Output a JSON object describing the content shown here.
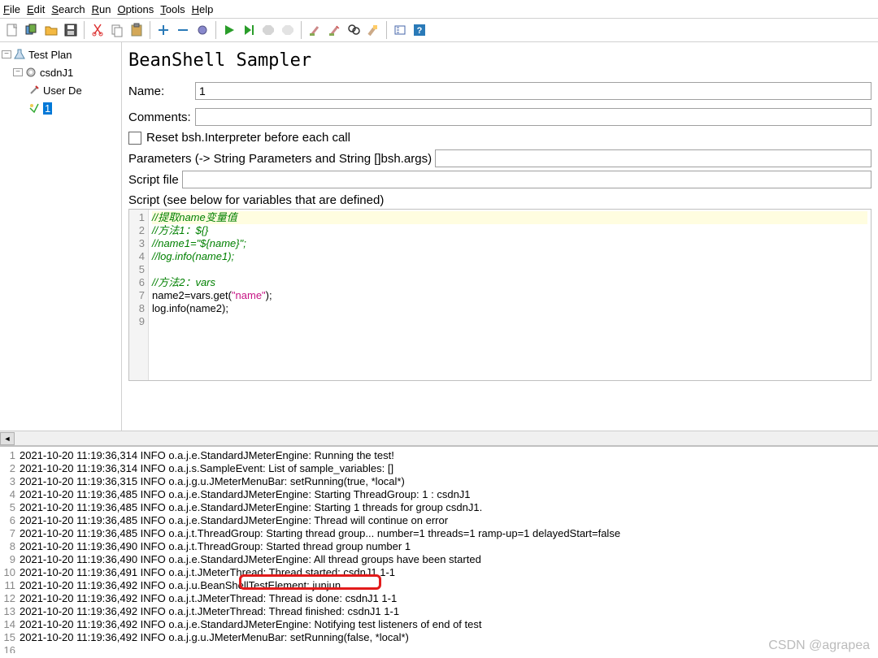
{
  "menu": {
    "items": [
      "File",
      "Edit",
      "Search",
      "Run",
      "Options",
      "Tools",
      "Help"
    ],
    "keys": [
      "F",
      "E",
      "S",
      "R",
      "O",
      "T",
      "H"
    ]
  },
  "tree": {
    "root": "Test Plan",
    "n1": "csdnJ1",
    "n2": "User De",
    "n3": "1"
  },
  "editor": {
    "title": "BeanShell Sampler",
    "name_label": "Name:",
    "name_value": "1",
    "comments_label": "Comments:",
    "comments_value": "",
    "reset_label": "Reset bsh.Interpreter before each call",
    "params_label": "Parameters (-> String Parameters and String []bsh.args)",
    "params_value": "",
    "scriptfile_label": "Script file",
    "scriptfile_value": "",
    "script_label": "Script (see below for variables that are defined)"
  },
  "code": {
    "l1": "//提取name变量值",
    "l2": "//方法1：${}",
    "l3": "//name1=\"${name}\";",
    "l4": "//log.info(name1);",
    "l6": "//方法2：vars",
    "l7a": "name2=vars.get(",
    "l7s": "\"name\"",
    "l7b": ");",
    "l8": "log.info(name2);"
  },
  "log": {
    "lines": [
      "2021-10-20 11:19:36,314 INFO o.a.j.e.StandardJMeterEngine: Running the test!",
      "2021-10-20 11:19:36,314 INFO o.a.j.s.SampleEvent: List of sample_variables: []",
      "2021-10-20 11:19:36,315 INFO o.a.j.g.u.JMeterMenuBar: setRunning(true, *local*)",
      "2021-10-20 11:19:36,485 INFO o.a.j.e.StandardJMeterEngine: Starting ThreadGroup: 1 : csdnJ1",
      "2021-10-20 11:19:36,485 INFO o.a.j.e.StandardJMeterEngine: Starting 1 threads for group csdnJ1.",
      "2021-10-20 11:19:36,485 INFO o.a.j.e.StandardJMeterEngine: Thread will continue on error",
      "2021-10-20 11:19:36,485 INFO o.a.j.t.ThreadGroup: Starting thread group... number=1 threads=1 ramp-up=1 delayedStart=false",
      "2021-10-20 11:19:36,490 INFO o.a.j.t.ThreadGroup: Started thread group number 1",
      "2021-10-20 11:19:36,490 INFO o.a.j.e.StandardJMeterEngine: All thread groups have been started",
      "2021-10-20 11:19:36,491 INFO o.a.j.t.JMeterThread: Thread started: csdnJ1 1-1",
      "2021-10-20 11:19:36,492 INFO o.a.j.u.BeanShellTestElement: junjun",
      "2021-10-20 11:19:36,492 INFO o.a.j.t.JMeterThread: Thread is done: csdnJ1 1-1",
      "2021-10-20 11:19:36,492 INFO o.a.j.t.JMeterThread: Thread finished: csdnJ1 1-1",
      "2021-10-20 11:19:36,492 INFO o.a.j.e.StandardJMeterEngine: Notifying test listeners of end of test",
      "2021-10-20 11:19:36,492 INFO o.a.j.g.u.JMeterMenuBar: setRunning(false, *local*)",
      ""
    ]
  },
  "watermark": "CSDN @agrapea"
}
